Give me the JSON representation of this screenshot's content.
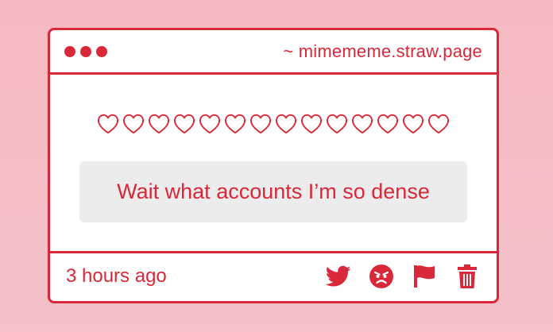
{
  "window": {
    "url": "~ mimememe.straw.page",
    "dots": [
      "window-dot",
      "window-dot",
      "window-dot"
    ]
  },
  "reaction": {
    "hearts_count": 14,
    "heart_symbol": "♡"
  },
  "message": {
    "text": "Wait what accounts I’m so dense"
  },
  "footer": {
    "time": "3 hours ago",
    "actions": [
      {
        "name": "twitter-icon"
      },
      {
        "name": "angry-face-icon"
      },
      {
        "name": "flag-icon"
      },
      {
        "name": "trash-icon"
      }
    ]
  },
  "colors": {
    "accent": "#d8283a",
    "background": "#f6b9c1",
    "card": "#ffffff",
    "message_bg": "#ececec"
  }
}
